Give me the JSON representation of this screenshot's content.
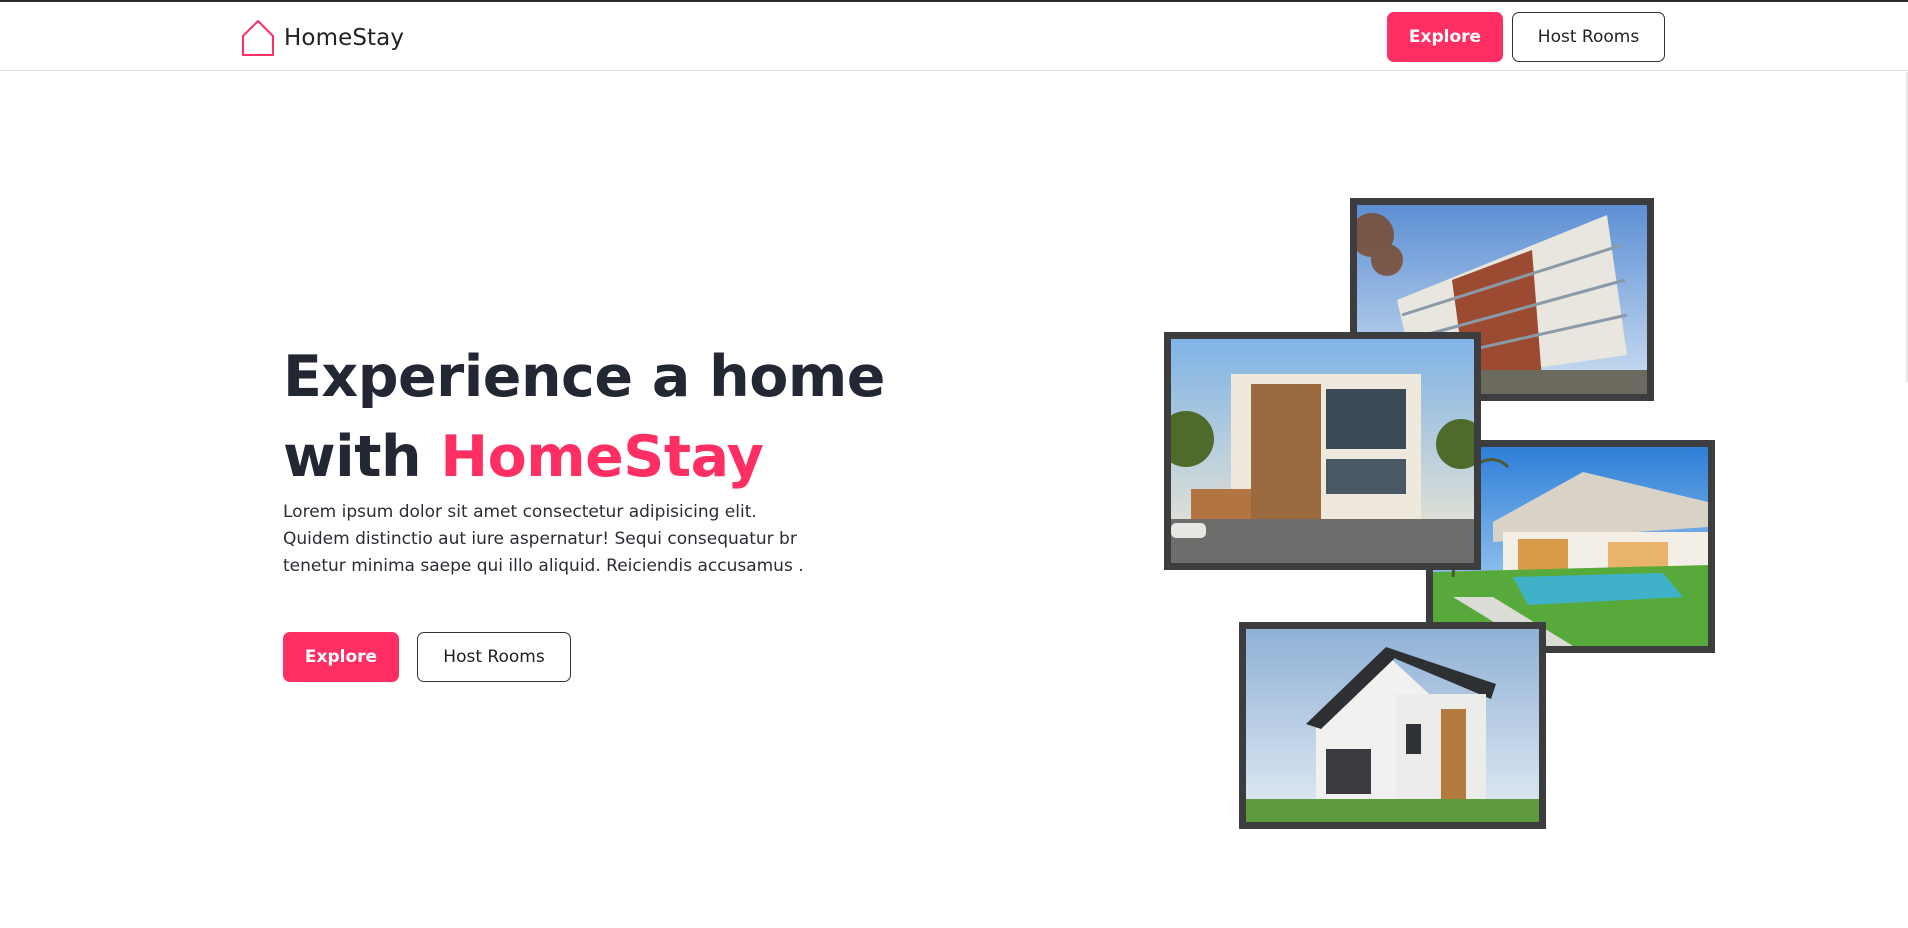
{
  "header": {
    "brand_name": "HomeStay",
    "explore_label": "Explore",
    "host_rooms_label": "Host Rooms"
  },
  "hero": {
    "title_line1": "Experience a home",
    "title_with": "with ",
    "title_brand": "HomeStay",
    "description": "Lorem ipsum dolor sit amet consectetur adipisicing elit. Quidem distinctio aut iure aspernatur! Sequi consequatur br tenetur minima saepe qui illo aliquid. Reiciendis accusamus .",
    "explore_label": "Explore",
    "host_rooms_label": "Host Rooms"
  },
  "gallery": {
    "photos": [
      "modern-apartment-building-photo",
      "modern-villa-photo",
      "pool-house-photo",
      "suburban-house-photo"
    ]
  },
  "colors": {
    "accent": "#ff2e63",
    "text_dark": "#232733",
    "photo_border": "#3d3d40"
  }
}
